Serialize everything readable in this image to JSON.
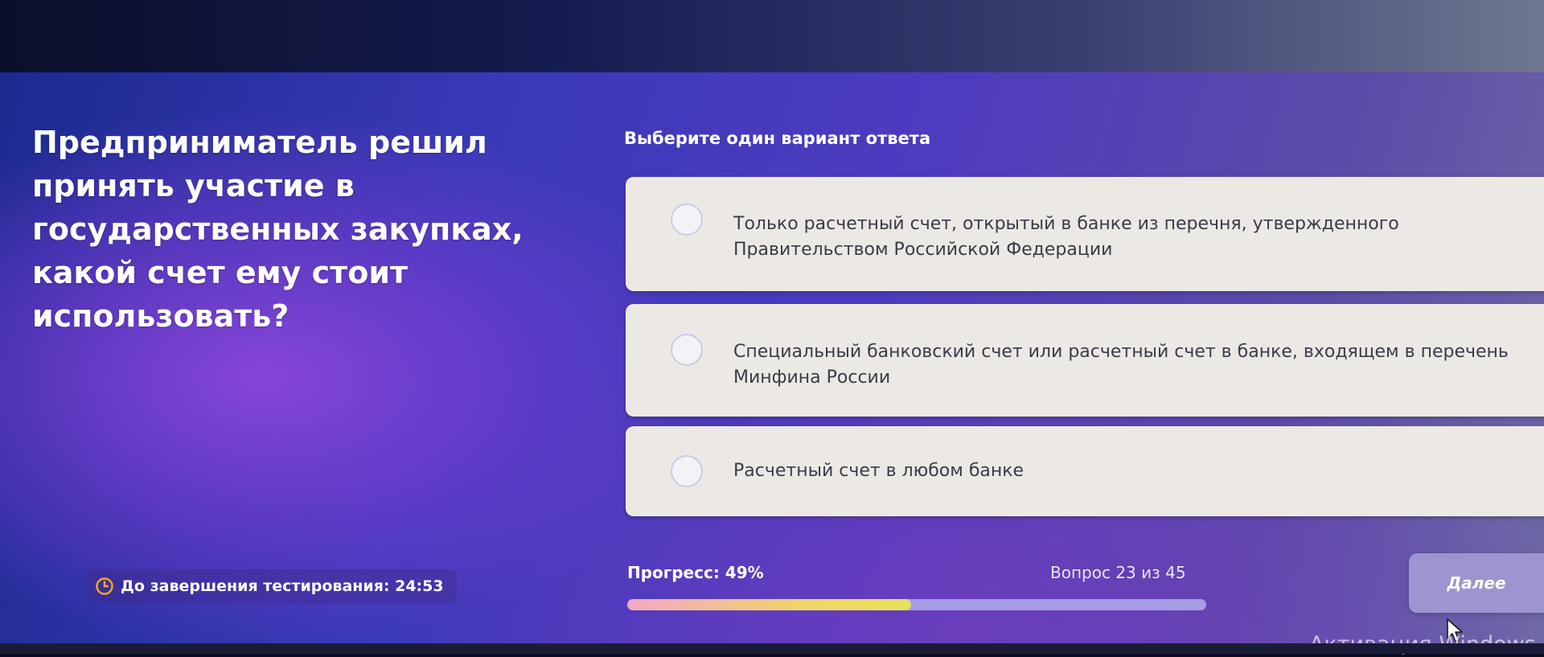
{
  "question": {
    "text": "Предприниматель решил принять участие в государственных закупках, какой счет ему стоит использовать?"
  },
  "answer_section": {
    "instruction": "Выберите один вариант ответа",
    "options": [
      {
        "label": "Только расчетный счет, открытый в банке из перечня, утвержденного Правительством Российской Федерации"
      },
      {
        "label": "Специальный банковский счет или расчетный счет в банке, входящем в перечень Минфина России"
      },
      {
        "label": "Расчетный счет в любом банке"
      }
    ]
  },
  "footer": {
    "timer_text": "До завершения тестирования: 24:53",
    "progress_label": "Прогресс: 49%",
    "progress_value": 49,
    "question_counter": "Вопрос 23 из 45",
    "next_label": "Далее"
  },
  "system": {
    "watermark": "Активация Windows"
  },
  "icons": {
    "timer": "clock-icon",
    "cursor": "mouse-cursor-icon",
    "radio": "radio-button-icon"
  },
  "colors": {
    "accent_timer": "#f6a623",
    "option_background": "#ece9e4",
    "progress_track": "#a79ce6",
    "next_button": "#9c95cf"
  }
}
